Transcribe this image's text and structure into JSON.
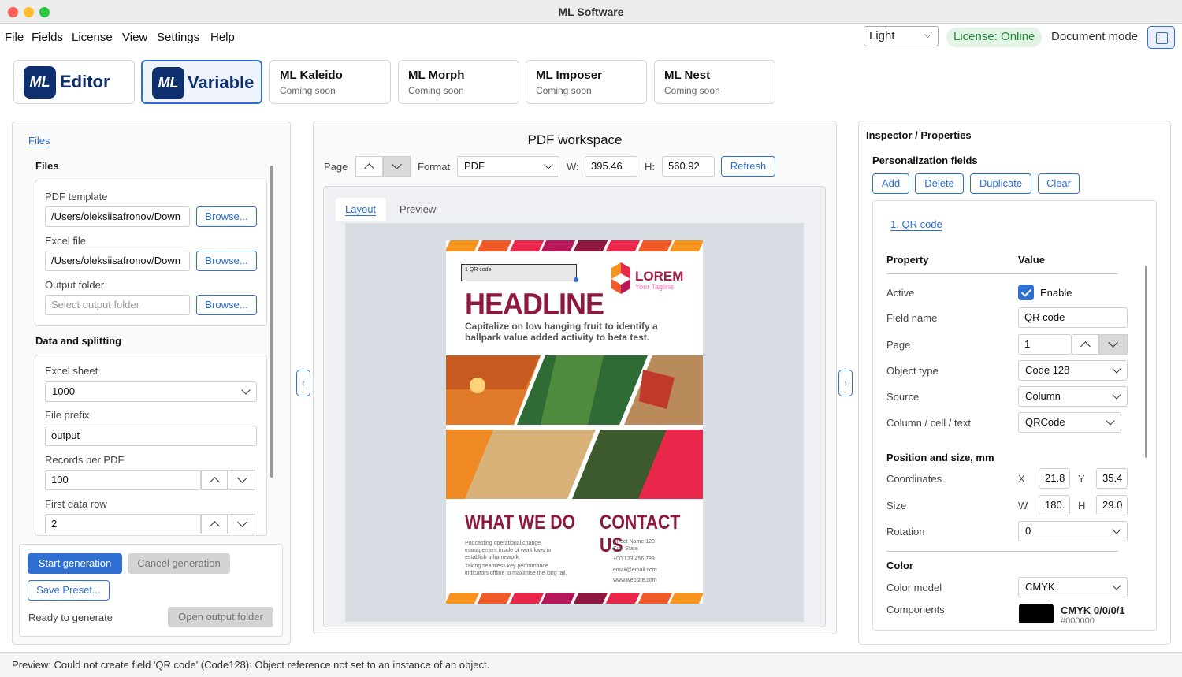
{
  "window": {
    "title": "ML Software"
  },
  "menu": [
    "File",
    "Fields",
    "License",
    "View",
    "Settings",
    "Help"
  ],
  "topbar": {
    "theme": "Light",
    "license": "License: Online",
    "mode_label": "Document mode"
  },
  "apps": [
    {
      "logo": "ML",
      "word": "Editor"
    },
    {
      "logo": "ML",
      "word": "Variable"
    },
    {
      "name": "ML Kaleido",
      "sub": "Coming soon"
    },
    {
      "name": "ML Morph",
      "sub": "Coming soon"
    },
    {
      "name": "ML Imposer",
      "sub": "Coming soon"
    },
    {
      "name": "ML Nest",
      "sub": "Coming soon"
    }
  ],
  "left": {
    "tab": "Files",
    "files_title": "Files",
    "pdf_template_label": "PDF template",
    "pdf_template_value": "/Users/oleksiisafronov/Down",
    "excel_label": "Excel file",
    "excel_value": "/Users/oleksiisafronov/Down",
    "output_label": "Output folder",
    "output_placeholder": "Select output folder",
    "browse": "Browse...",
    "data_title": "Data and splitting",
    "sheet_label": "Excel sheet",
    "sheet_value": "1000",
    "prefix_label": "File prefix",
    "prefix_value": "output",
    "records_label": "Records per PDF",
    "records_value": "100",
    "first_row_label": "First data row",
    "first_row_value": "2",
    "start": "Start generation",
    "cancel": "Cancel generation",
    "save_preset": "Save Preset...",
    "status": "Ready to generate",
    "open_output": "Open output folder"
  },
  "workspace": {
    "title": "PDF workspace",
    "page_label": "Page",
    "format_label": "Format",
    "format_value": "PDF",
    "w_label": "W:",
    "w_value": "395.46",
    "h_label": "H:",
    "h_value": "560.92",
    "refresh": "Refresh",
    "tab_layout": "Layout",
    "tab_preview": "Preview"
  },
  "poster": {
    "qr_label": "1  QR code",
    "logo_text": "LOREM",
    "logo_tagline": "Your Tagline",
    "headline": "HEADLINE",
    "subline": "Capitalize on low hanging fruit to identify a ballpark value added activity to beta test.",
    "what_title": "WHAT WE DO",
    "what_p1": "Podcasting operational change management inside of workflows to establish a framework.",
    "what_p2": "Taking seamless key performance indicators offline to maximise the long tail.",
    "contact_title": "CONTACT US",
    "address": "Street Name 123\nCity, State",
    "phone": "+00 123 456 789",
    "email": "email@email.com",
    "web": "www.website.com",
    "stripe_colors": [
      "#f7941d",
      "#f15a29",
      "#e8274b",
      "#b5175a",
      "#8e1740",
      "#e8274b",
      "#f15a29",
      "#f7941d"
    ]
  },
  "inspector": {
    "title": "Inspector / Properties",
    "fields_title": "Personalization fields",
    "add": "Add",
    "delete": "Delete",
    "duplicate": "Duplicate",
    "clear": "Clear",
    "field_tab": "1. QR code",
    "col_property": "Property",
    "col_value": "Value",
    "active_label": "Active",
    "enable": "Enable",
    "field_name_label": "Field name",
    "field_name_value": "QR code",
    "page_label": "Page",
    "page_value": "1",
    "object_type_label": "Object type",
    "object_type_value": "Code 128",
    "source_label": "Source",
    "source_value": "Column",
    "column_label": "Column / cell / text",
    "column_value": "QRCode",
    "pos_title": "Position and size, mm",
    "coords_label": "Coordinates",
    "x_label": "X",
    "x_value": "21.8",
    "y_label": "Y",
    "y_value": "35.4",
    "size_label": "Size",
    "w_label": "W",
    "w_value": "180.",
    "h_label": "H",
    "h_value": "29.0",
    "rotation_label": "Rotation",
    "rotation_value": "0",
    "color_title": "Color",
    "color_model_label": "Color model",
    "color_model_value": "CMYK",
    "components_label": "Components",
    "cmyk_value": "CMYK 0/0/0/1",
    "hex_value": "#000000"
  },
  "statusbar": "Preview: Could not create field 'QR code' (Code128): Object reference not set to an instance of an object."
}
